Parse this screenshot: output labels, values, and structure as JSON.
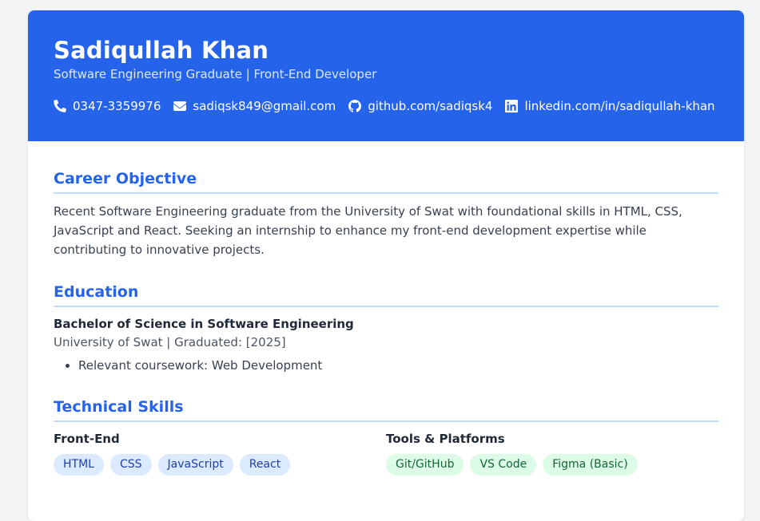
{
  "header": {
    "name": "Sadiqullah Khan",
    "subtitle": "Software Engineering Graduate | Front-End Developer",
    "contacts": {
      "phone": {
        "icon": "phone-icon",
        "text": "0347-3359976"
      },
      "email": {
        "icon": "envelope-icon",
        "text": "sadiqsk849@gmail.com"
      },
      "github": {
        "icon": "github-icon",
        "text": "github.com/sadiqsk4"
      },
      "linkedin": {
        "icon": "linkedin-icon",
        "text": "linkedin.com/in/sadiqullah-khan"
      }
    }
  },
  "objective": {
    "title": "Career Objective",
    "text": "Recent Software Engineering graduate from the University of Swat with foundational skills in HTML, CSS, JavaScript and React. Seeking an internship to enhance my front-end development expertise while contributing to innovative projects."
  },
  "education": {
    "title": "Education",
    "degree": "Bachelor of Science in Software Engineering",
    "school": "University of Swat | Graduated: [2025]",
    "coursework": [
      "Relevant coursework: Web Development"
    ]
  },
  "skills": {
    "title": "Technical Skills",
    "frontend": {
      "heading": "Front-End",
      "tags": [
        "HTML",
        "CSS",
        "JavaScript",
        "React"
      ]
    },
    "tools": {
      "heading": "Tools & Platforms",
      "tags": [
        "Git/GitHub",
        "VS Code",
        "Figma (Basic)"
      ]
    }
  },
  "colors": {
    "accent": "#2563eb",
    "tag_blue_bg": "#dbeafe",
    "tag_green_bg": "#dcfce7"
  }
}
